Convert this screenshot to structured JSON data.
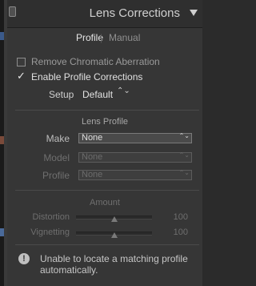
{
  "header": {
    "title": "Lens Corrections"
  },
  "tabs": {
    "profile": "Profile",
    "separator": "|",
    "manual": "Manual"
  },
  "options": {
    "remove_ca": {
      "label": "Remove Chromatic Aberration",
      "checked": false
    },
    "enable_profile": {
      "label": "Enable Profile Corrections",
      "checked": true,
      "mark": "✓"
    }
  },
  "setup": {
    "label": "Setup",
    "value": "Default",
    "stepper": "⌃⌄"
  },
  "lens_profile": {
    "title": "Lens Profile",
    "make": {
      "label": "Make",
      "value": "None"
    },
    "model": {
      "label": "Model",
      "value": "None"
    },
    "profile": {
      "label": "Profile",
      "value": "None"
    },
    "arrows": "⌃⌄"
  },
  "amount": {
    "title": "Amount",
    "distortion": {
      "label": "Distortion",
      "value": "100",
      "level": 0.5
    },
    "vignetting": {
      "label": "Vignetting",
      "value": "100",
      "level": 0.5
    }
  },
  "warning": {
    "icon": "!",
    "message": "Unable to locate a matching profile automatically."
  },
  "colors": {
    "panel_bg": "#363636",
    "header_bg": "#2f2f2f",
    "text": "#b9b9b9"
  }
}
